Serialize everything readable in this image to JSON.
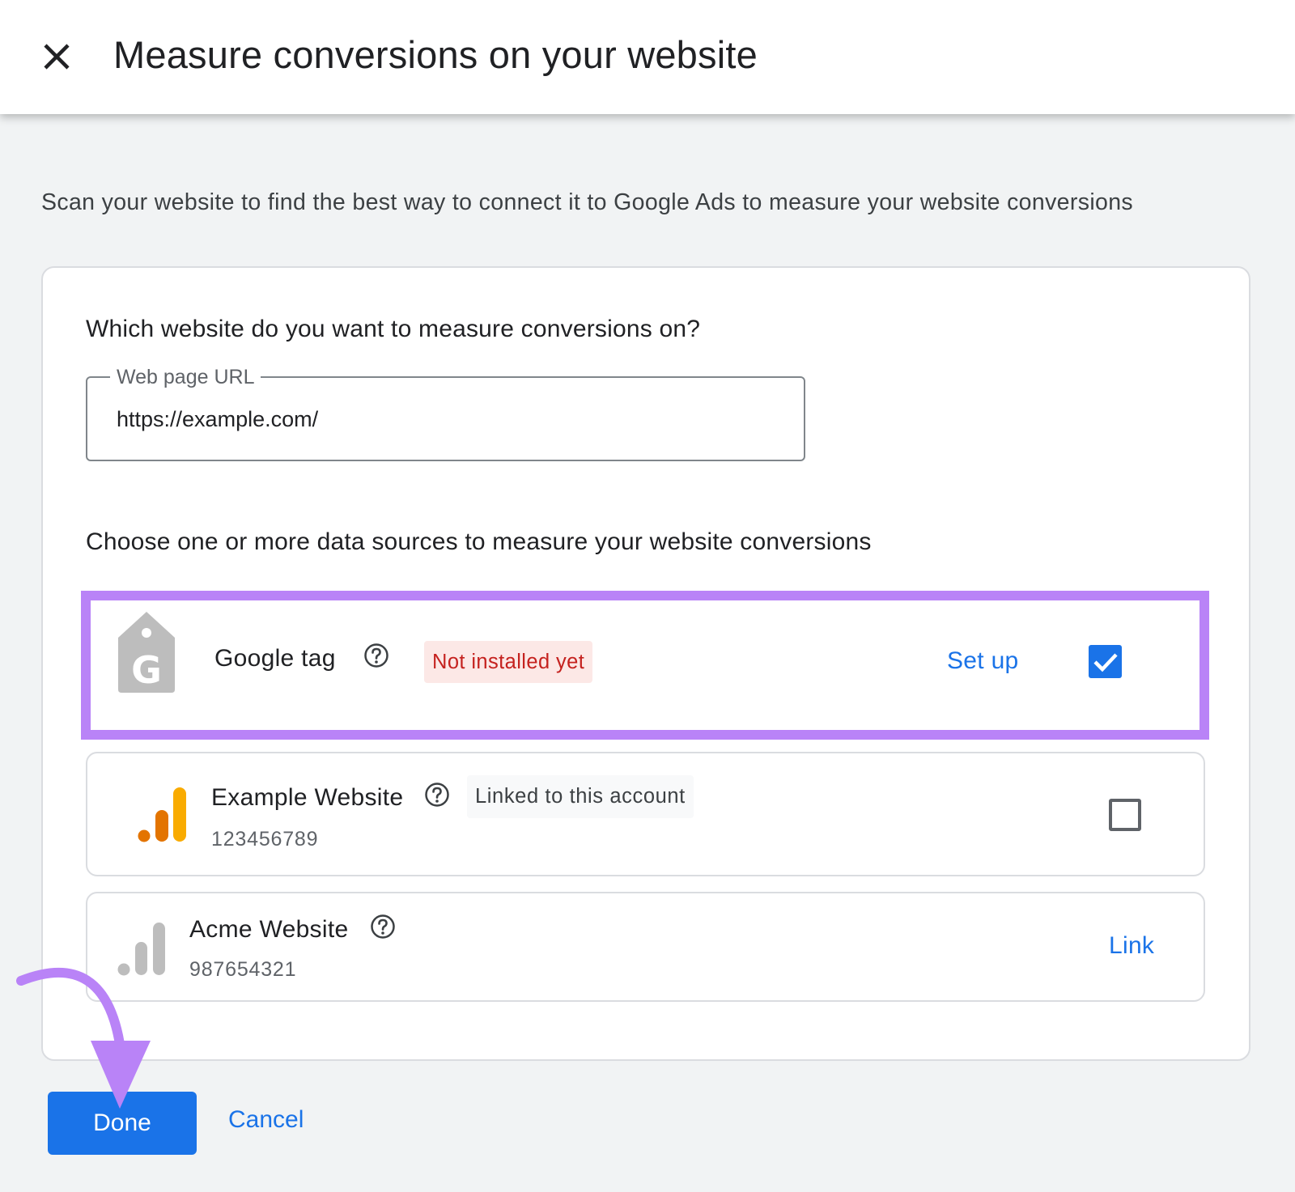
{
  "header": {
    "title": "Measure conversions on your website"
  },
  "intro": "Scan your website to find the best way to connect it to Google Ads to measure your website conversions",
  "website_section": {
    "question": "Which website do you want to measure conversions on?",
    "url_field": {
      "label": "Web page URL",
      "value": "https://example.com/"
    }
  },
  "sources_section": {
    "heading": "Choose one or more data sources to measure your website conversions",
    "sources": [
      {
        "name": "Google tag",
        "icon": "google-tag-icon",
        "badge": "Not installed yet",
        "action": "Set up",
        "checked": true
      },
      {
        "name": "Example Website",
        "id": "123456789",
        "icon": "analytics-icon",
        "badge": "Linked to this account",
        "checked": false
      },
      {
        "name": "Acme Website",
        "id": "987654321",
        "icon": "analytics-grey-icon",
        "action": "Link"
      }
    ]
  },
  "footer": {
    "done_label": "Done",
    "cancel_label": "Cancel"
  },
  "colors": {
    "accent": "#1a73e8",
    "highlight": "#b983f7",
    "analytics_orange": "#f9ab00",
    "analytics_dark_orange": "#e37400",
    "error_text": "#c5221f",
    "error_bg": "#fce8e6"
  }
}
